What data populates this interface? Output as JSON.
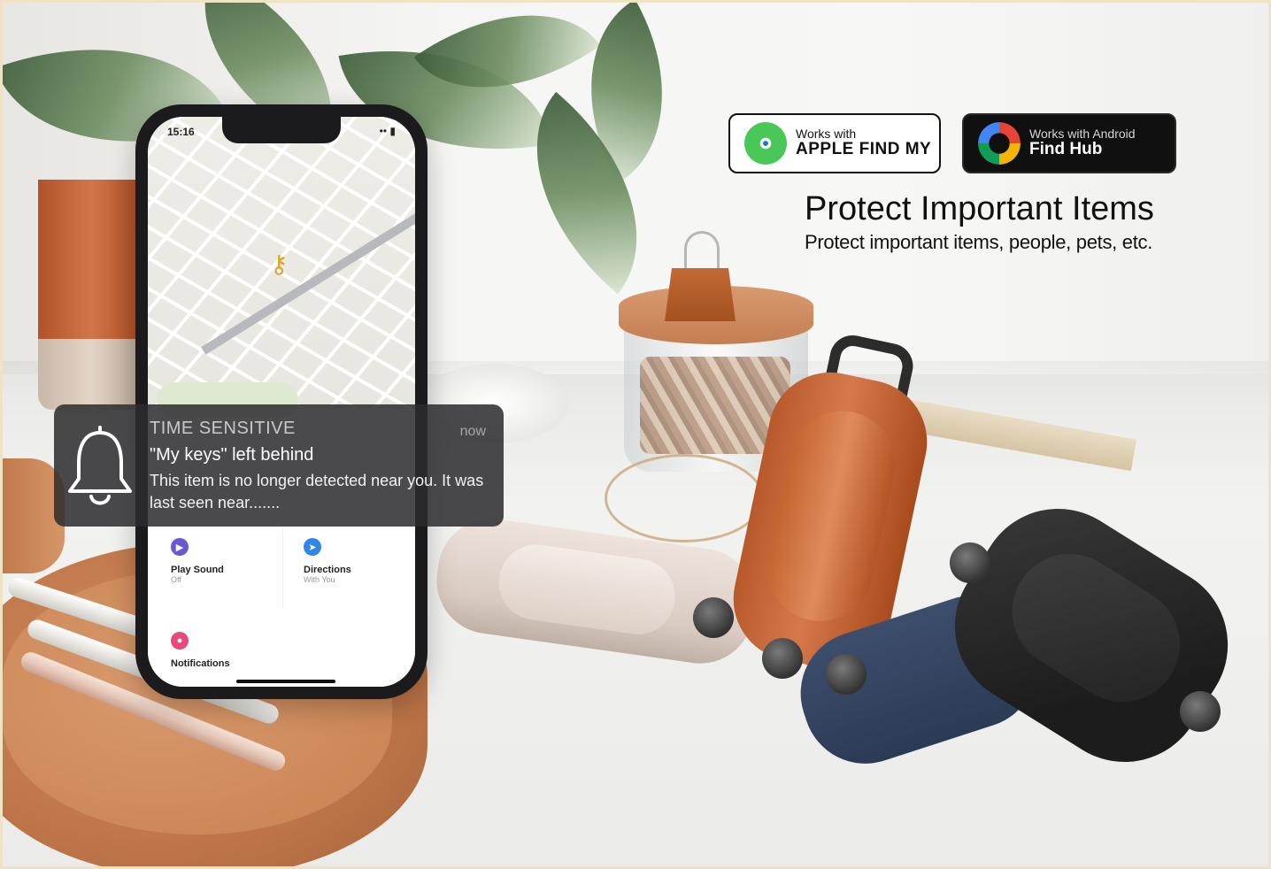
{
  "headline": {
    "title": "Protect Important Items",
    "subtitle": "Protect important items, people, pets, etc."
  },
  "badges": {
    "apple": {
      "small": "Works with",
      "big": "APPLE FIND MY"
    },
    "android": {
      "small": "Works with Android",
      "big": "Find Hub"
    }
  },
  "phone": {
    "status_time": "15:16",
    "status_icons": "•• ▮",
    "actions": [
      {
        "name": "Play Sound",
        "sub": "Off",
        "icon": "play-icon",
        "color": "#6b57d6"
      },
      {
        "name": "Directions",
        "sub": "With You",
        "icon": "directions-icon",
        "color": "#2f86e6"
      },
      {
        "name": "Notifications",
        "sub": "",
        "icon": "bell-icon",
        "color": "#e64a7a"
      }
    ]
  },
  "notification": {
    "label": "TIME SENSITIVE",
    "time": "now",
    "title": "\"My keys\" left behind",
    "body": "This item is no longer detected near you. It was last seen near......."
  }
}
